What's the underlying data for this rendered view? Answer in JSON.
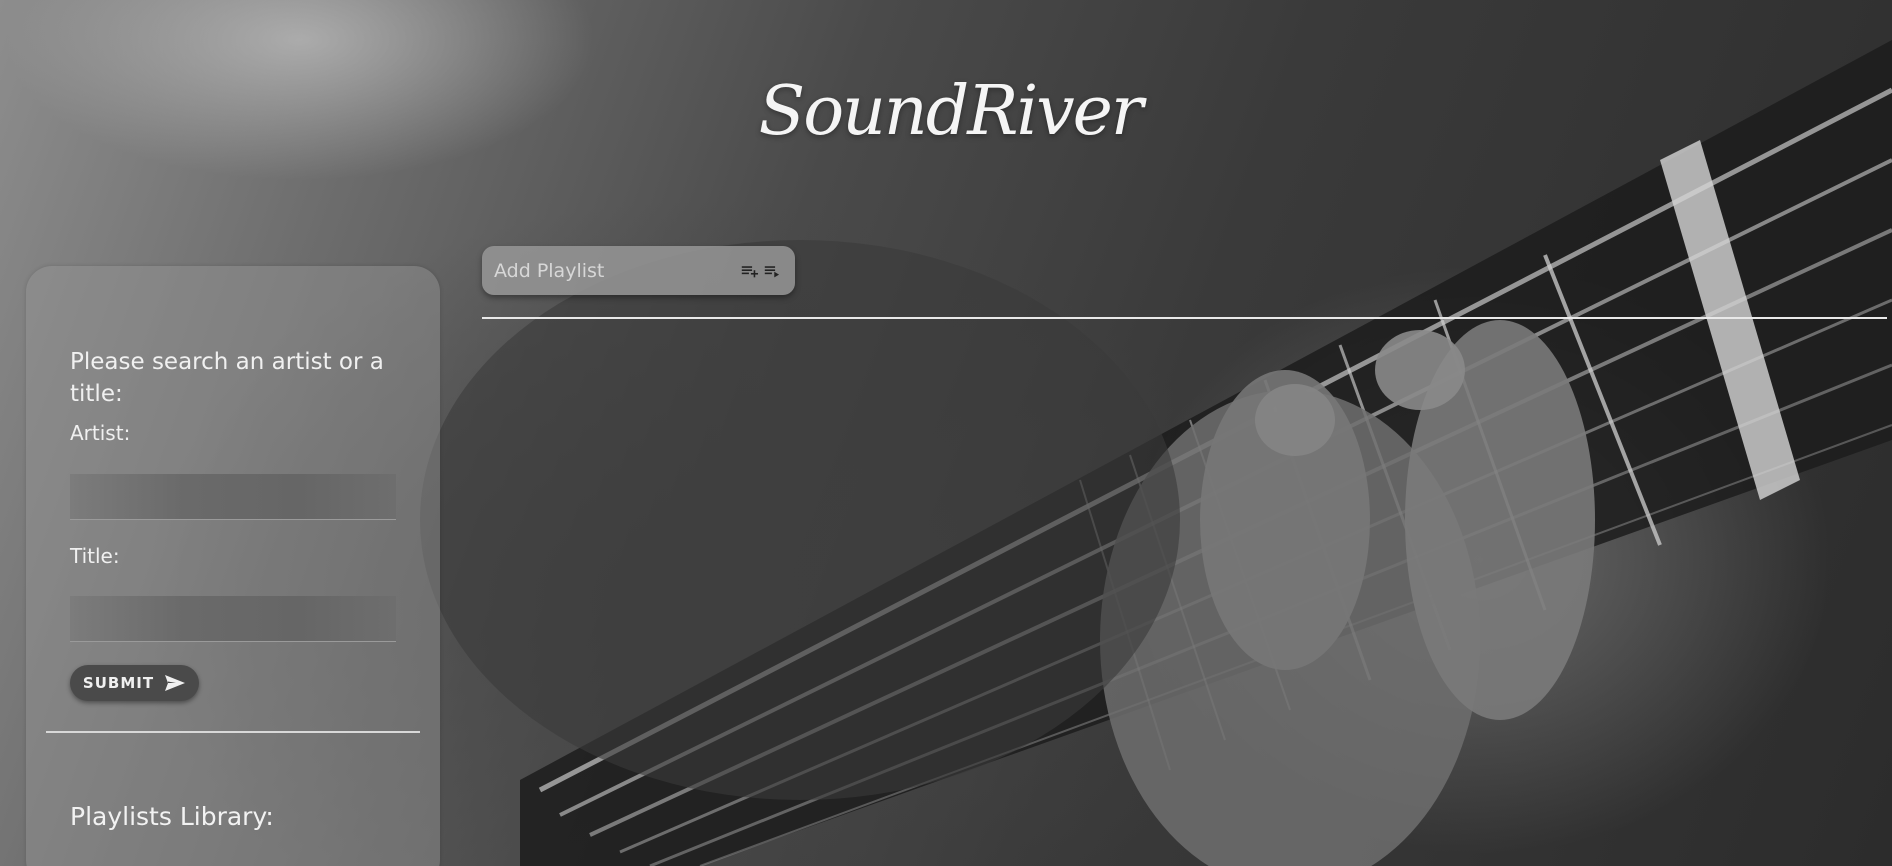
{
  "app": {
    "logo_text": "SoundRiver"
  },
  "playlist": {
    "placeholder": "Add Playlist",
    "add_icon": "playlist-add-icon",
    "play_icon": "playlist-play-icon"
  },
  "sidebar": {
    "search_prompt": "Please search an artist or a title:",
    "artist_label": "Artist:",
    "artist_value": "",
    "title_label": "Title:",
    "title_value": "",
    "submit_label": "SUBMIT",
    "submit_icon": "send-icon",
    "library_title": "Playlists Library:"
  },
  "colors": {
    "panel": "#969696",
    "button": "#4a4a4a",
    "text": "#f0f0f0",
    "rule": "#e9e9e9"
  }
}
